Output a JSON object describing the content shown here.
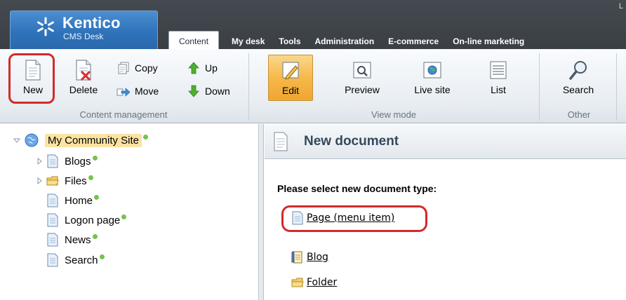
{
  "header": {
    "logo_title": "Kentico",
    "logo_subtitle": "CMS Desk",
    "topright": "L",
    "tabs": [
      "Content",
      "My desk",
      "Tools",
      "Administration",
      "E-commerce",
      "On-line marketing"
    ]
  },
  "ribbon": {
    "content_management": {
      "label": "Content management",
      "new": "New",
      "delete": "Delete",
      "copy": "Copy",
      "move": "Move",
      "up": "Up",
      "down": "Down"
    },
    "view_mode": {
      "label": "View mode",
      "edit": "Edit",
      "preview": "Preview",
      "live_site": "Live site",
      "list": "List"
    },
    "other": {
      "label": "Other",
      "search": "Search"
    }
  },
  "tree": {
    "root": "My Community Site",
    "items": [
      {
        "label": "Blogs",
        "icon": "page-icon",
        "expandable": true
      },
      {
        "label": "Files",
        "icon": "folder-icon",
        "expandable": true
      },
      {
        "label": "Home",
        "icon": "page-icon",
        "expandable": false
      },
      {
        "label": "Logon page",
        "icon": "page-icon",
        "expandable": false
      },
      {
        "label": "News",
        "icon": "page-icon",
        "expandable": false
      },
      {
        "label": "Search",
        "icon": "page-icon",
        "expandable": false
      }
    ]
  },
  "content": {
    "title": "New document",
    "prompt": "Please select new document type:",
    "types": [
      {
        "label": "Page (menu item)",
        "icon": "page-icon"
      },
      {
        "label": "Blog",
        "icon": "blog-icon"
      },
      {
        "label": "Folder",
        "icon": "folder-icon"
      }
    ]
  },
  "colors": {
    "highlight_ring": "#d12b2b",
    "selected_button": "#f6b94a",
    "published_dot": "#74c34e"
  }
}
